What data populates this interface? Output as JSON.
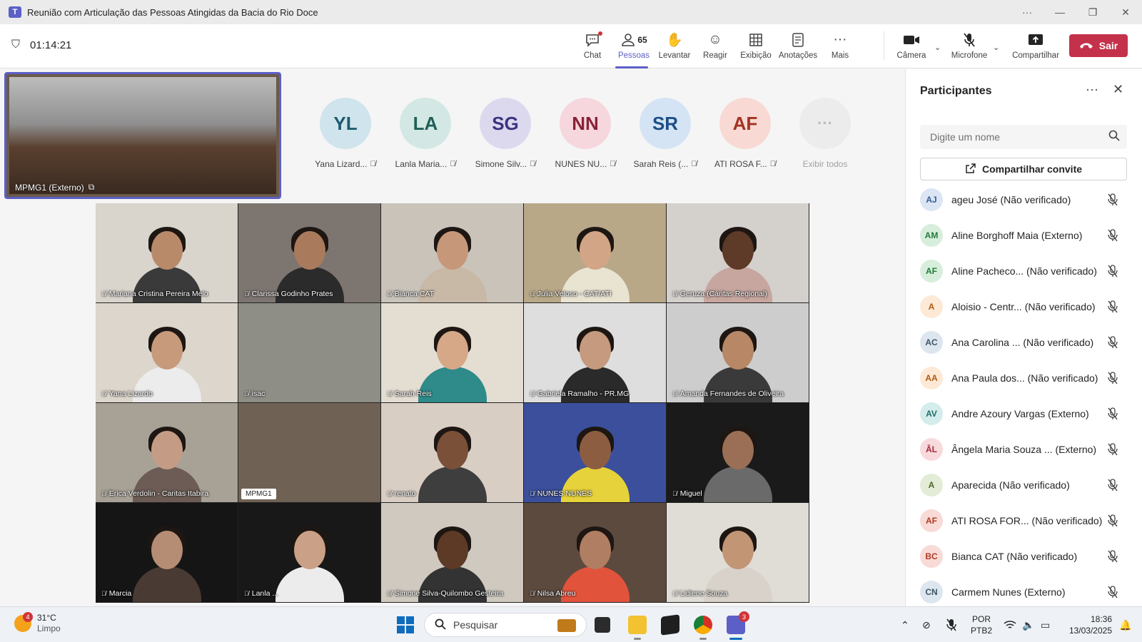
{
  "window": {
    "title": "Reunião com Articulação das Pessoas Atingidas da Bacia do Rio Doce",
    "controls": [
      "···",
      "—",
      "❐",
      "✕"
    ]
  },
  "meeting": {
    "timer": "01:14:21",
    "toolbar": {
      "chat": "Chat",
      "people": "Pessoas",
      "people_count": "65",
      "raise_hand": "Levantar",
      "react": "Reagir",
      "view": "Exibição",
      "notes": "Anotações",
      "more": "Mais",
      "camera": "Câmera",
      "microphone": "Microfone",
      "share": "Compartilhar",
      "leave": "Sair"
    },
    "accent": "#5b5fc7",
    "leave_color": "#c4314b"
  },
  "pinned": {
    "name": "MPMG1 (Externo)"
  },
  "avatars": [
    {
      "initials": "YL",
      "name": "Yana Lizard...",
      "bg": "#cfe4ec",
      "fg": "#1e5a6e"
    },
    {
      "initials": "LA",
      "name": "Lanla Maria...",
      "bg": "#d3e8e4",
      "fg": "#1f5f57"
    },
    {
      "initials": "SG",
      "name": "Simone Silv...",
      "bg": "#dcd9ef",
      "fg": "#3b3480"
    },
    {
      "initials": "NN",
      "name": "NUNES NU...",
      "bg": "#f6d7dd",
      "fg": "#8a2136"
    },
    {
      "initials": "SR",
      "name": "Sarah Reis (...",
      "bg": "#d4e4f4",
      "fg": "#1d4f86"
    },
    {
      "initials": "AF",
      "name": "ATI ROSA F...",
      "bg": "#f8d9d3",
      "fg": "#a33222"
    }
  ],
  "avatar_more": {
    "icon": "···",
    "label": "Exibir todos"
  },
  "tiles": [
    {
      "name": "Mariana Cristina Pereira Melo",
      "bg": "#d9d4cc",
      "skin": "#b88a6a",
      "shirt": "#3a3a3a",
      "muted": true
    },
    {
      "name": "Clarissa Godinho Prates",
      "bg": "#7d7570",
      "skin": "#a97a5c",
      "shirt": "#2b2b2b",
      "muted": true
    },
    {
      "name": "Bianca CAT",
      "bg": "#c9c3ba",
      "skin": "#c7977a",
      "shirt": "#c8b8a6",
      "muted": true
    },
    {
      "name": "Julia Veloso - CAT/ATI",
      "bg": "#b8a888",
      "skin": "#d1a585",
      "shirt": "#e9e3d2",
      "muted": true
    },
    {
      "name": "Geruza (Cáritas Regional)",
      "bg": "#d4d0cc",
      "skin": "#5e3a28",
      "shirt": "#c7a6a0",
      "muted": true
    },
    {
      "name": "Yana Lizardo",
      "bg": "#dcd6cc",
      "skin": "#c79a7c",
      "shirt": "#ececec",
      "muted": true
    },
    {
      "name": "isac",
      "bg": "#8e8d86",
      "skin": "#8e8d86",
      "shirt": "#8e8d86",
      "muted": true
    },
    {
      "name": "Sarah Reis",
      "bg": "#e4ddd2",
      "skin": "#d6a888",
      "shirt": "#2f8a8a",
      "muted": true
    },
    {
      "name": "Gabriela Ramalho - PR.MG",
      "bg": "#dedede",
      "skin": "#c59a7e",
      "shirt": "#2a2a2a",
      "muted": true
    },
    {
      "name": "Amanda Fernandes de Oliveira",
      "bg": "#cdcdcd",
      "skin": "#b78766",
      "shirt": "#3a3a3a",
      "muted": true
    },
    {
      "name": "Erica Verdolin - Caritas Itabira",
      "bg": "#a7a196",
      "skin": "#c49c86",
      "shirt": "#6c5c55",
      "muted": true
    },
    {
      "name": "MPMG1",
      "bg": "#6f6255",
      "skin": "#6f6255",
      "shirt": "#6f6255",
      "muted": false
    },
    {
      "name": "renato",
      "bg": "#d8cec4",
      "skin": "#7a5038",
      "shirt": "#3e3e3e",
      "muted": true
    },
    {
      "name": "NUNES NUNES",
      "bg": "#3b4f9c",
      "skin": "#8d5d42",
      "shirt": "#e6d23a",
      "muted": true
    },
    {
      "name": "Miguel",
      "bg": "#1a1a1a",
      "skin": "#9a6f55",
      "shirt": "#6a6a6a",
      "muted": true
    },
    {
      "name": "Marcia",
      "bg": "#151515",
      "skin": "#b58c74",
      "shirt": "#4a3a34",
      "muted": true
    },
    {
      "name": "Lanla ...",
      "bg": "#181818",
      "skin": "#caa186",
      "shirt": "#ececec",
      "muted": true
    },
    {
      "name": "Simone Silva-Quilombo Gesteira",
      "bg": "#cfc9c0",
      "skin": "#5c3a26",
      "shirt": "#333333",
      "muted": true
    },
    {
      "name": "Nilsa Abreu",
      "bg": "#5d4a3e",
      "skin": "#b07e62",
      "shirt": "#e2533c",
      "muted": true
    },
    {
      "name": "Lidiene Souza",
      "bg": "#e0dcd6",
      "skin": "#c29574",
      "shirt": "#d8d2ca",
      "muted": true
    }
  ],
  "panel": {
    "title": "Participantes",
    "search_placeholder": "Digite um nome",
    "invite_label": "Compartilhar convite",
    "participants": [
      {
        "initials": "AJ",
        "name": "ageu José (Não verificado)",
        "bg": "#dbe5f4",
        "fg": "#3a5a8c"
      },
      {
        "initials": "AM",
        "name": "Aline Borghoff Maia (Externo)",
        "bg": "#d8eedc",
        "fg": "#237b3a"
      },
      {
        "initials": "AF",
        "name": "Aline Pacheco... (Não verificado)",
        "bg": "#d8eedc",
        "fg": "#237b3a"
      },
      {
        "initials": "A",
        "name": "Aloisio - Centr... (Não verificado)",
        "bg": "#fde9d6",
        "fg": "#b05a10"
      },
      {
        "initials": "AC",
        "name": "Ana Carolina ... (Não verificado)",
        "bg": "#dde6ee",
        "fg": "#3d5568"
      },
      {
        "initials": "AA",
        "name": "Ana Paula dos... (Não verificado)",
        "bg": "#fde9d6",
        "fg": "#b05a10"
      },
      {
        "initials": "AV",
        "name": "Andre Azoury Vargas (Externo)",
        "bg": "#d4eceb",
        "fg": "#1f6f6b"
      },
      {
        "initials": "ÂL",
        "name": "Ângela Maria Souza ... (Externo)",
        "bg": "#f8dadd",
        "fg": "#a32a3a"
      },
      {
        "initials": "A",
        "name": "Aparecida (Não verificado)",
        "bg": "#e3ecd6",
        "fg": "#4c6a22"
      },
      {
        "initials": "AF",
        "name": "ATI ROSA FOR... (Não verificado)",
        "bg": "#f8dad6",
        "fg": "#b03a26"
      },
      {
        "initials": "BC",
        "name": "Bianca CAT (Não verificado)",
        "bg": "#f8dad6",
        "fg": "#b03a26"
      },
      {
        "initials": "CN",
        "name": "Carmem Nunes (Externo)",
        "bg": "#dde6ee",
        "fg": "#3d5568"
      }
    ]
  },
  "taskbar": {
    "weather_temp": "31°C",
    "weather_desc": "Limpo",
    "weather_badge": "4",
    "search_label": "Pesquisar",
    "teams_badge": "3",
    "lang_1": "POR",
    "lang_2": "PTB2",
    "time": "18:36",
    "date": "13/03/2025"
  }
}
